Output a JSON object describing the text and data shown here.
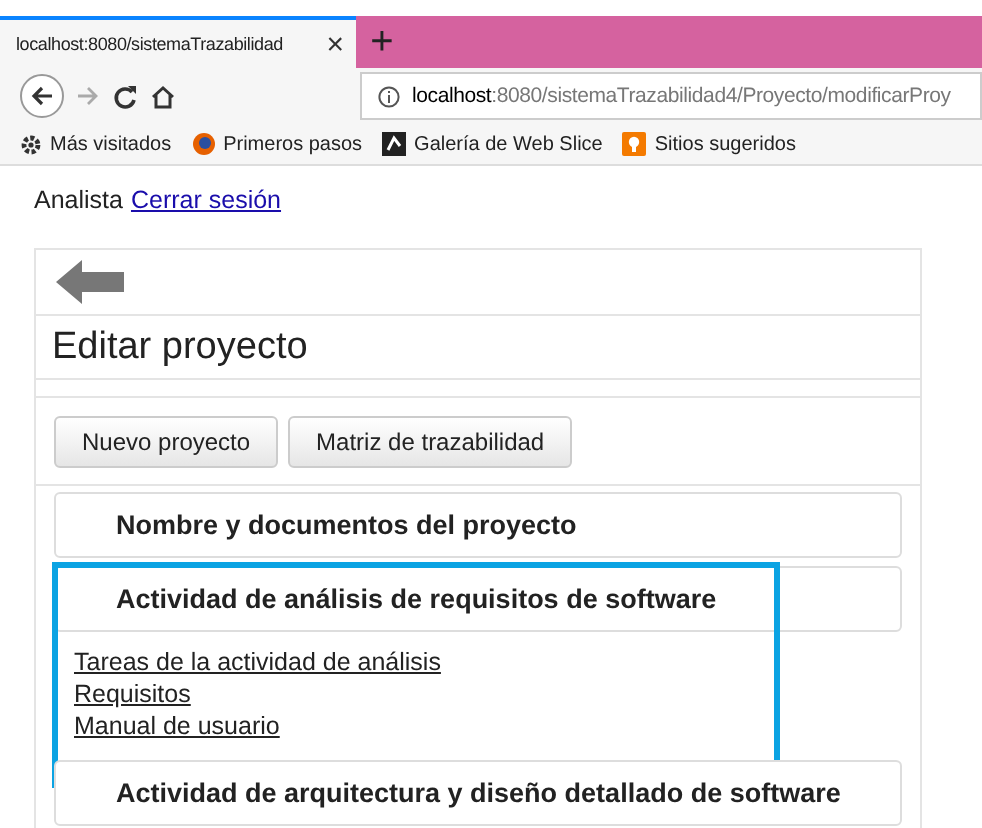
{
  "browser": {
    "tab_title": "localhost:8080/sistemaTrazabilidad",
    "new_tab": "+",
    "close": "×",
    "url_host": "localhost",
    "url_rest": ":8080/sistemaTrazabilidad4/Proyecto/modificarProy",
    "bookmarks": [
      "Más visitados",
      "Primeros pasos",
      "Galería de Web Slice",
      "Sitios sugeridos"
    ]
  },
  "user": {
    "role": "Analista",
    "logout": "Cerrar sesión"
  },
  "page": {
    "title": "Editar proyecto",
    "buttons": [
      "Nuevo proyecto",
      "Matriz de trazabilidad"
    ],
    "sections": [
      {
        "title": "Nombre y documentos del proyecto",
        "expanded": false,
        "highlighted": false
      },
      {
        "title": "Actividad de análisis de requisitos de software",
        "expanded": true,
        "highlighted": true,
        "links": [
          "Tareas de la actividad de análisis",
          "Requisitos",
          "Manual de usuario"
        ]
      },
      {
        "title": "Actividad de arquitectura y diseño detallado de software",
        "expanded": false,
        "highlighted": false
      }
    ]
  }
}
